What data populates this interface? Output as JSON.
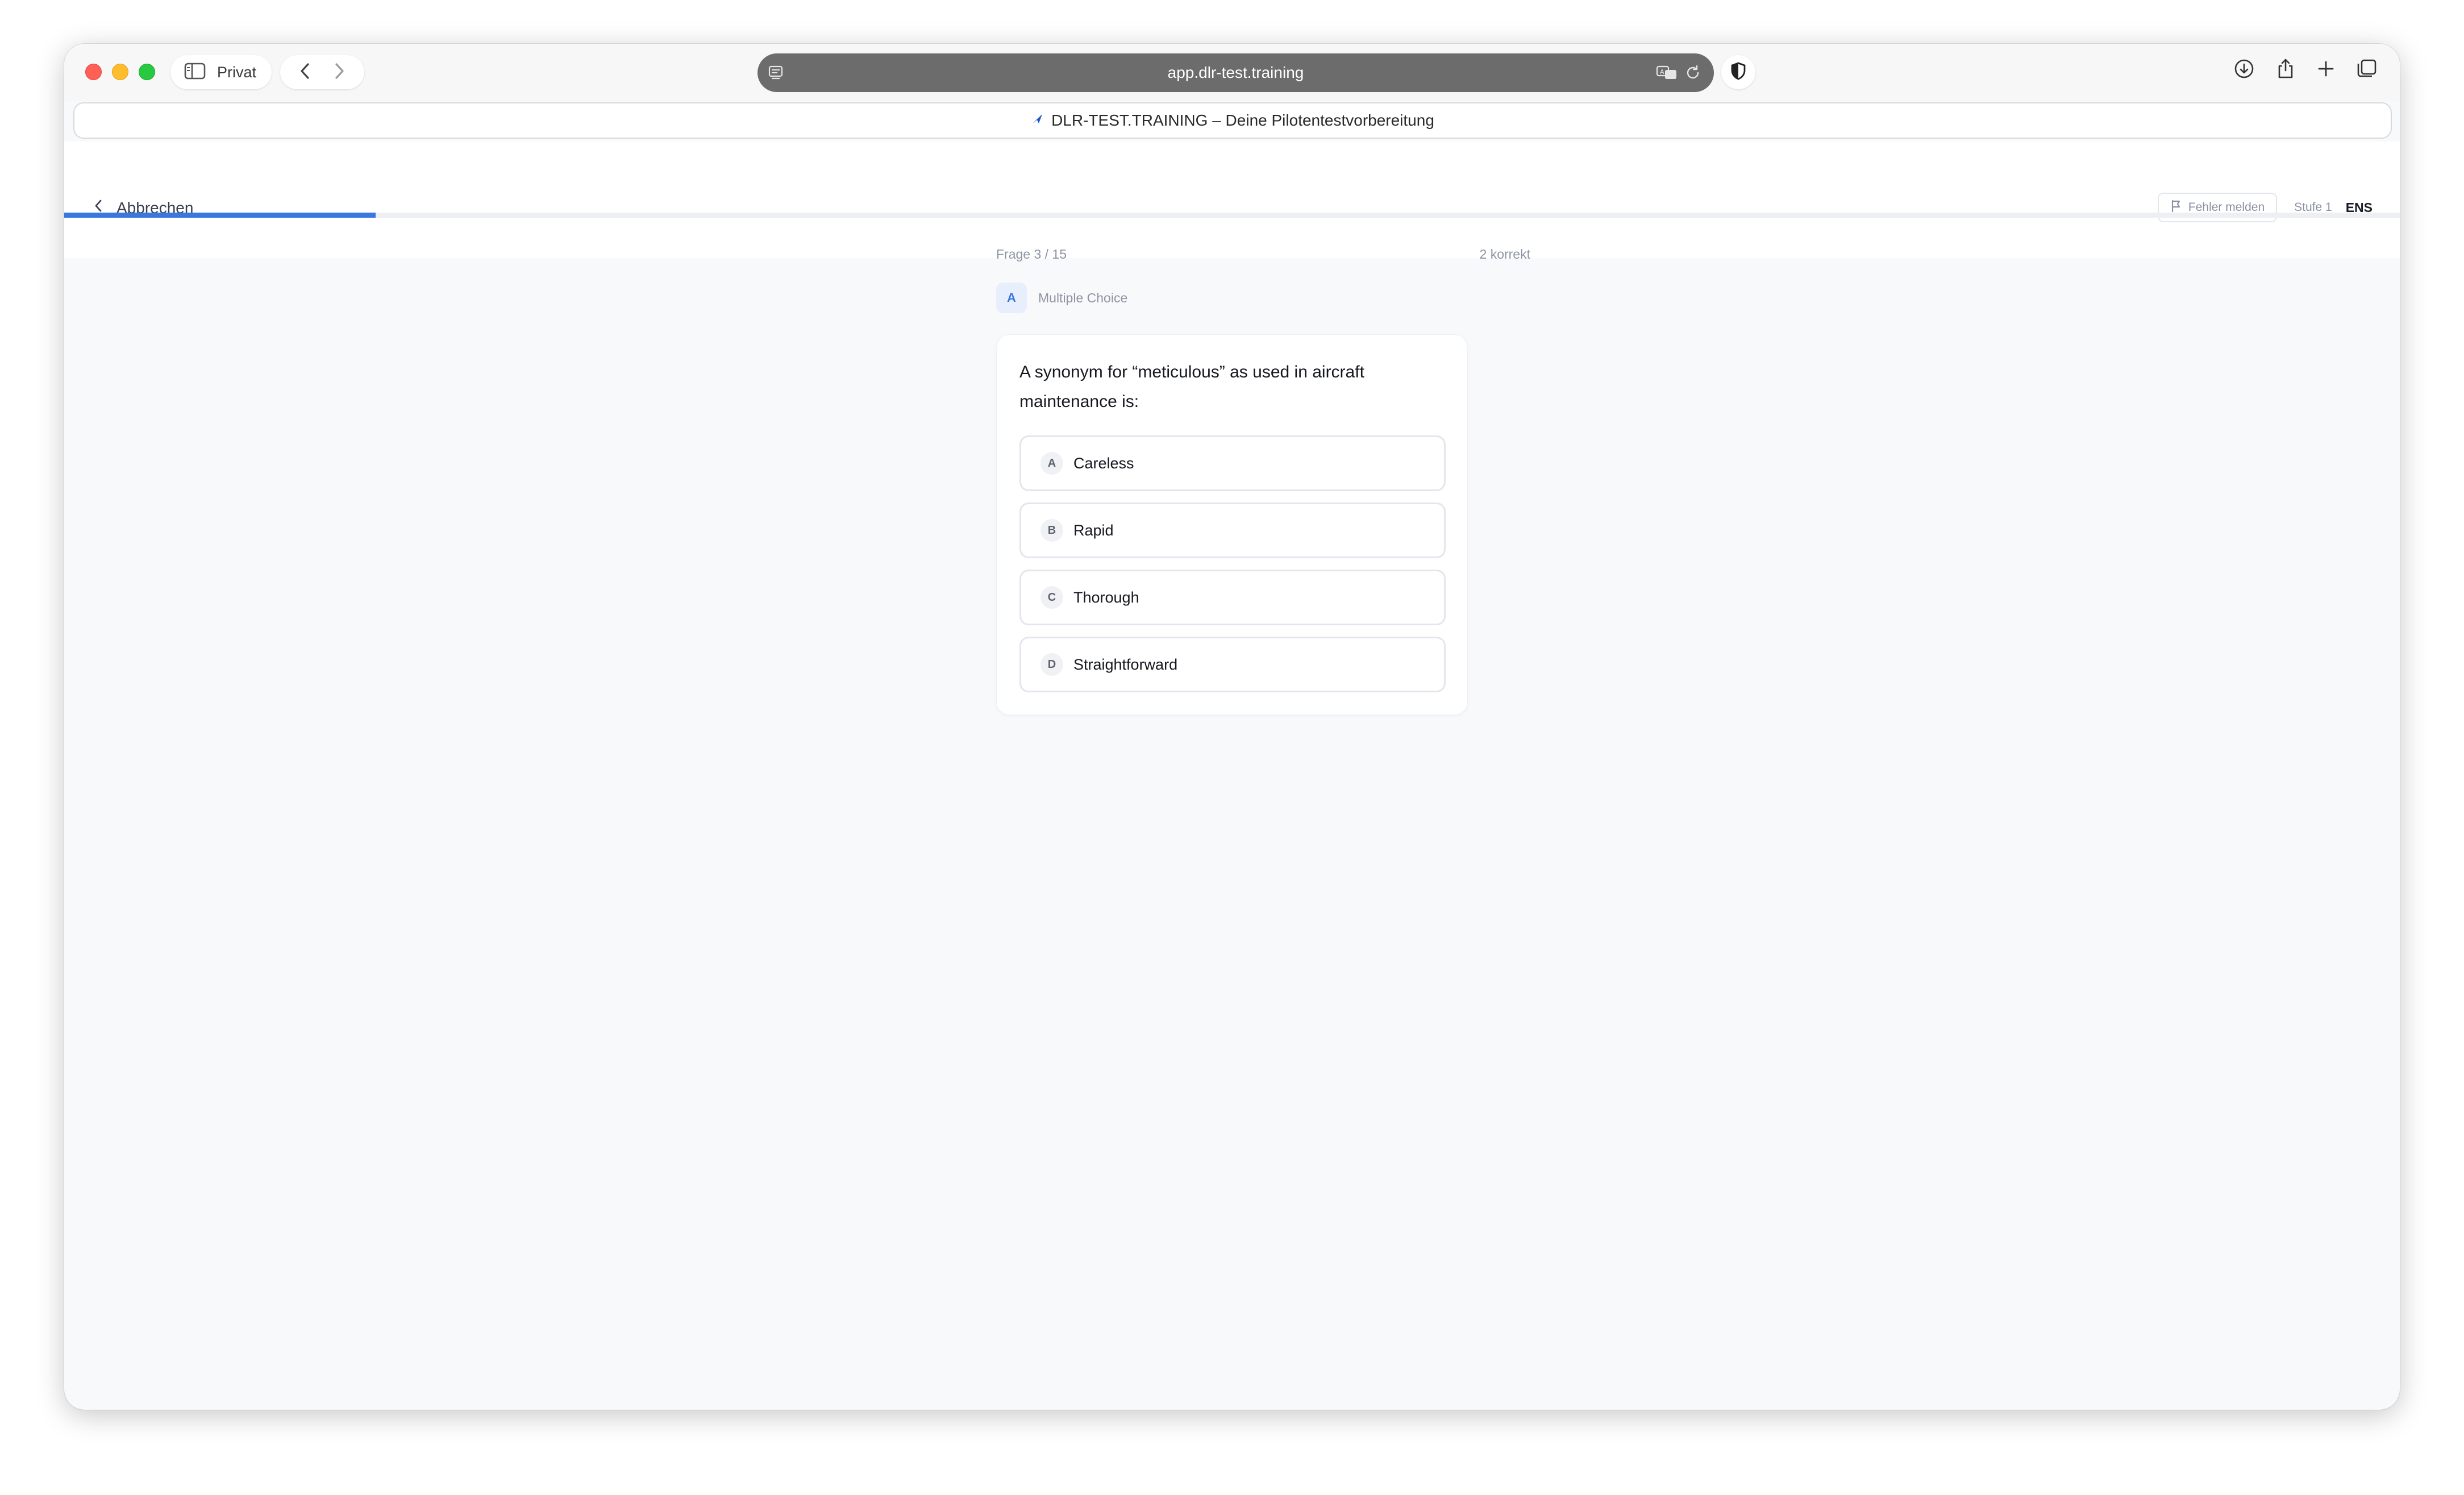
{
  "browser": {
    "private_label": "Privat",
    "url": "app.dlr-test.training",
    "tab_title": "DLR-TEST.TRAINING – Deine Pilotentestvorbereitung",
    "icons": [
      "sidebar-icon",
      "back-icon",
      "forward-icon",
      "reader-icon",
      "translate-icon",
      "reload-icon",
      "shield-icon",
      "download-icon",
      "share-icon",
      "new-tab-icon",
      "tab-overview-icon"
    ]
  },
  "header": {
    "cancel_label": "Abbrechen",
    "report_label": "Fehler melden",
    "level_label": "Stufe 1",
    "language_label": "ENS"
  },
  "progress": {
    "fraction": 0.1333
  },
  "quiz": {
    "counter": "Frage 3 / 15",
    "correct_count": "2 korrekt",
    "type_badge": "A",
    "type_label": "Multiple Choice",
    "question": "A synonym for “meticulous” as used in aircraft maintenance is:",
    "options": [
      {
        "letter": "A",
        "text": "Careless"
      },
      {
        "letter": "B",
        "text": "Rapid"
      },
      {
        "letter": "C",
        "text": "Thorough"
      },
      {
        "letter": "D",
        "text": "Straightforward"
      }
    ]
  },
  "colors": {
    "accent": "#3a78e0",
    "background": "#f8f9fb"
  }
}
